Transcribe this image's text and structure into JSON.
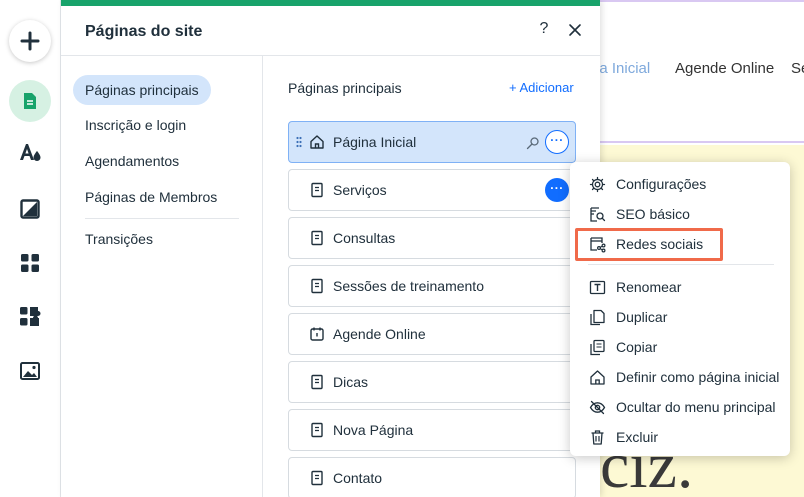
{
  "panel": {
    "title": "Páginas do site",
    "help": "?",
    "nav": [
      {
        "label": "Páginas principais",
        "active": true
      },
      {
        "label": "Inscrição e login",
        "active": false
      },
      {
        "label": "Agendamentos",
        "active": false
      },
      {
        "label": "Páginas de Membros",
        "active": false
      },
      {
        "label": "Transições",
        "active": false
      }
    ],
    "section_heading": "Páginas principais",
    "add_label": "+ Adicionar",
    "pages": [
      {
        "label": "Página Inicial",
        "icon": "home-icon",
        "selected": true
      },
      {
        "label": "Serviços",
        "icon": "page-icon",
        "selected": false
      },
      {
        "label": "Consultas",
        "icon": "page-icon",
        "selected": false
      },
      {
        "label": "Sessões de treinamento",
        "icon": "page-icon",
        "selected": false
      },
      {
        "label": "Agende Online",
        "icon": "calendar-icon",
        "selected": false
      },
      {
        "label": "Dicas",
        "icon": "page-icon",
        "selected": false
      },
      {
        "label": "Nova Página",
        "icon": "page-icon",
        "selected": false
      },
      {
        "label": "Contato",
        "icon": "page-icon",
        "selected": false
      }
    ]
  },
  "menu": {
    "items": [
      {
        "label": "Configurações",
        "icon": "gear-icon"
      },
      {
        "label": "SEO básico",
        "icon": "seo-icon"
      },
      {
        "label": "Redes sociais",
        "icon": "social-share-icon",
        "highlighted": true
      },
      {
        "label": "Renomear",
        "icon": "rename-icon"
      },
      {
        "label": "Duplicar",
        "icon": "duplicate-icon"
      },
      {
        "label": "Copiar",
        "icon": "copy-icon"
      },
      {
        "label": "Definir como página inicial",
        "icon": "home-icon"
      },
      {
        "label": "Ocultar do menu principal",
        "icon": "hide-icon"
      },
      {
        "label": "Excluir",
        "icon": "trash-icon"
      }
    ]
  },
  "canvas": {
    "nav": [
      "na Inicial",
      "Agende Online",
      "Se"
    ],
    "big_text": "ciz."
  },
  "colors": {
    "accent": "#116dff",
    "brand_green": "#18a36b",
    "highlight": "#f06a4a",
    "selected_bg": "#d3e5fb"
  }
}
